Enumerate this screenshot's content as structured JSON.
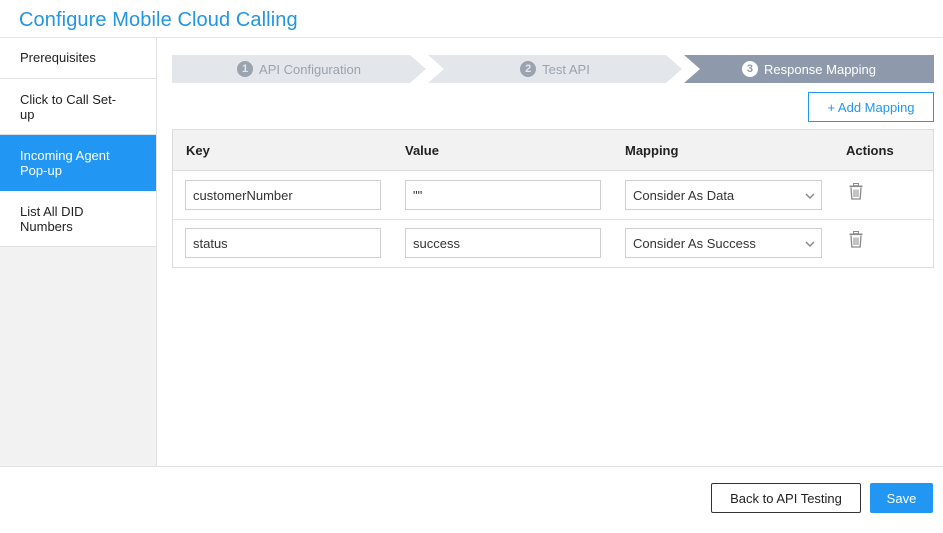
{
  "dialog": {
    "title": "Configure Mobile Cloud Calling"
  },
  "sidebar": {
    "items": [
      {
        "line1": "Prerequisites",
        "line2": ""
      },
      {
        "line1": "Click to Call Set-",
        "line2": "up"
      },
      {
        "line1": "Incoming Agent",
        "line2": "Pop-up",
        "active": true
      },
      {
        "line1": "List All DID",
        "line2": "Numbers"
      }
    ]
  },
  "stepper": {
    "steps": [
      {
        "number": "1",
        "label": "API Configuration",
        "state": "inactive"
      },
      {
        "number": "2",
        "label": "Test API",
        "state": "inactive"
      },
      {
        "number": "3",
        "label": "Response Mapping",
        "state": "active"
      }
    ]
  },
  "toolbar": {
    "add_mapping_label": "+ Add Mapping"
  },
  "table": {
    "headers": {
      "key": "Key",
      "value": "Value",
      "mapping": "Mapping",
      "actions": "Actions"
    },
    "rows": [
      {
        "key": "customerNumber",
        "value": "\"\"",
        "mapping": "Consider As Data"
      },
      {
        "key": "status",
        "value": "success",
        "mapping": "Consider As Success"
      }
    ]
  },
  "footer": {
    "back_label": "Back to API Testing",
    "save_label": "Save"
  },
  "colors": {
    "accent": "#2196f3",
    "step_inactive_bg": "#e3e7ec",
    "step_active_bg": "#8e9aab"
  },
  "icons": {
    "delete": "trash-icon",
    "dropdown": "chevron-down-icon"
  }
}
